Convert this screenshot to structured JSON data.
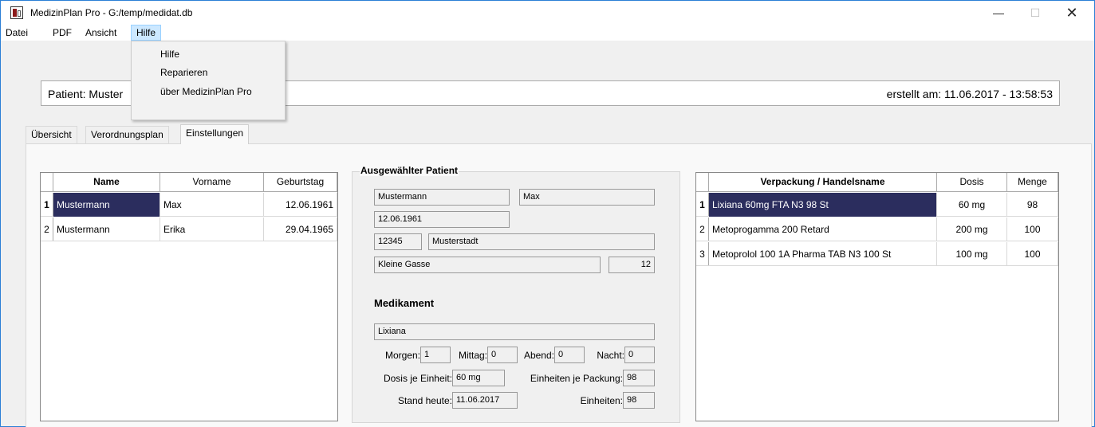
{
  "window": {
    "title": "MedizinPlan Pro - G:/temp/medidat.db",
    "minimize": "—",
    "maximize": "☐",
    "close": "✕"
  },
  "menu": {
    "items": [
      "Datei",
      "PDF",
      "Ansicht",
      "Hilfe"
    ],
    "active": "Hilfe",
    "dropdown": [
      "Hilfe",
      "Reparieren",
      "über MedizinPlan Pro"
    ]
  },
  "header": {
    "patient_label": "Patient: Muster",
    "created": "erstellt am: 11.06.2017 - 13:58:53"
  },
  "tabs": [
    "Übersicht",
    "Verordnungsplan",
    "Einstellungen"
  ],
  "active_tab": "Einstellungen",
  "patients_table": {
    "columns": [
      "Name",
      "Vorname",
      "Geburtstag"
    ],
    "rows": [
      {
        "num": "1",
        "name": "Mustermann",
        "vorname": "Max",
        "geburtstag": "12.06.1961"
      },
      {
        "num": "2",
        "name": "Mustermann",
        "vorname": "Erika",
        "geburtstag": "29.04.1965"
      }
    ]
  },
  "selected_patient": {
    "group_title": "Ausgewählter Patient",
    "lastname": "Mustermann",
    "firstname": "Max",
    "birthday": "12.06.1961",
    "zip": "12345",
    "city": "Musterstadt",
    "street": "Kleine Gasse",
    "house_number": "12"
  },
  "medication": {
    "title": "Medikament",
    "name": "Lixiana",
    "morgen_label": "Morgen:",
    "morgen": "1",
    "mittag_label": "Mittag:",
    "mittag": "0",
    "abend_label": "Abend:",
    "abend": "0",
    "nacht_label": "Nacht:",
    "nacht": "0",
    "dosis_label": "Dosis je Einheit:",
    "dosis": "60 mg",
    "einheiten_packung_label": "Einheiten je Packung:",
    "einheiten_packung": "98",
    "stand_label": "Stand heute:",
    "stand": "11.06.2017",
    "einheiten_label": "Einheiten:",
    "einheiten": "98"
  },
  "packages_table": {
    "columns": [
      "Verpackung / Handelsname",
      "Dosis",
      "Menge"
    ],
    "rows": [
      {
        "num": "1",
        "name": "Lixiana 60mg FTA N3 98 St",
        "dosis": "60 mg",
        "menge": "98"
      },
      {
        "num": "2",
        "name": "Metoprogamma 200 Retard",
        "dosis": "200 mg",
        "menge": "100"
      },
      {
        "num": "3",
        "name": "Metoprolol 100 1A Pharma TAB N3 100 St",
        "dosis": "100 mg",
        "menge": "100"
      }
    ]
  },
  "colors": {
    "selection": "#2b2d5e",
    "menu_highlight": "#cce8ff",
    "window_border": "#2b7fd6"
  }
}
